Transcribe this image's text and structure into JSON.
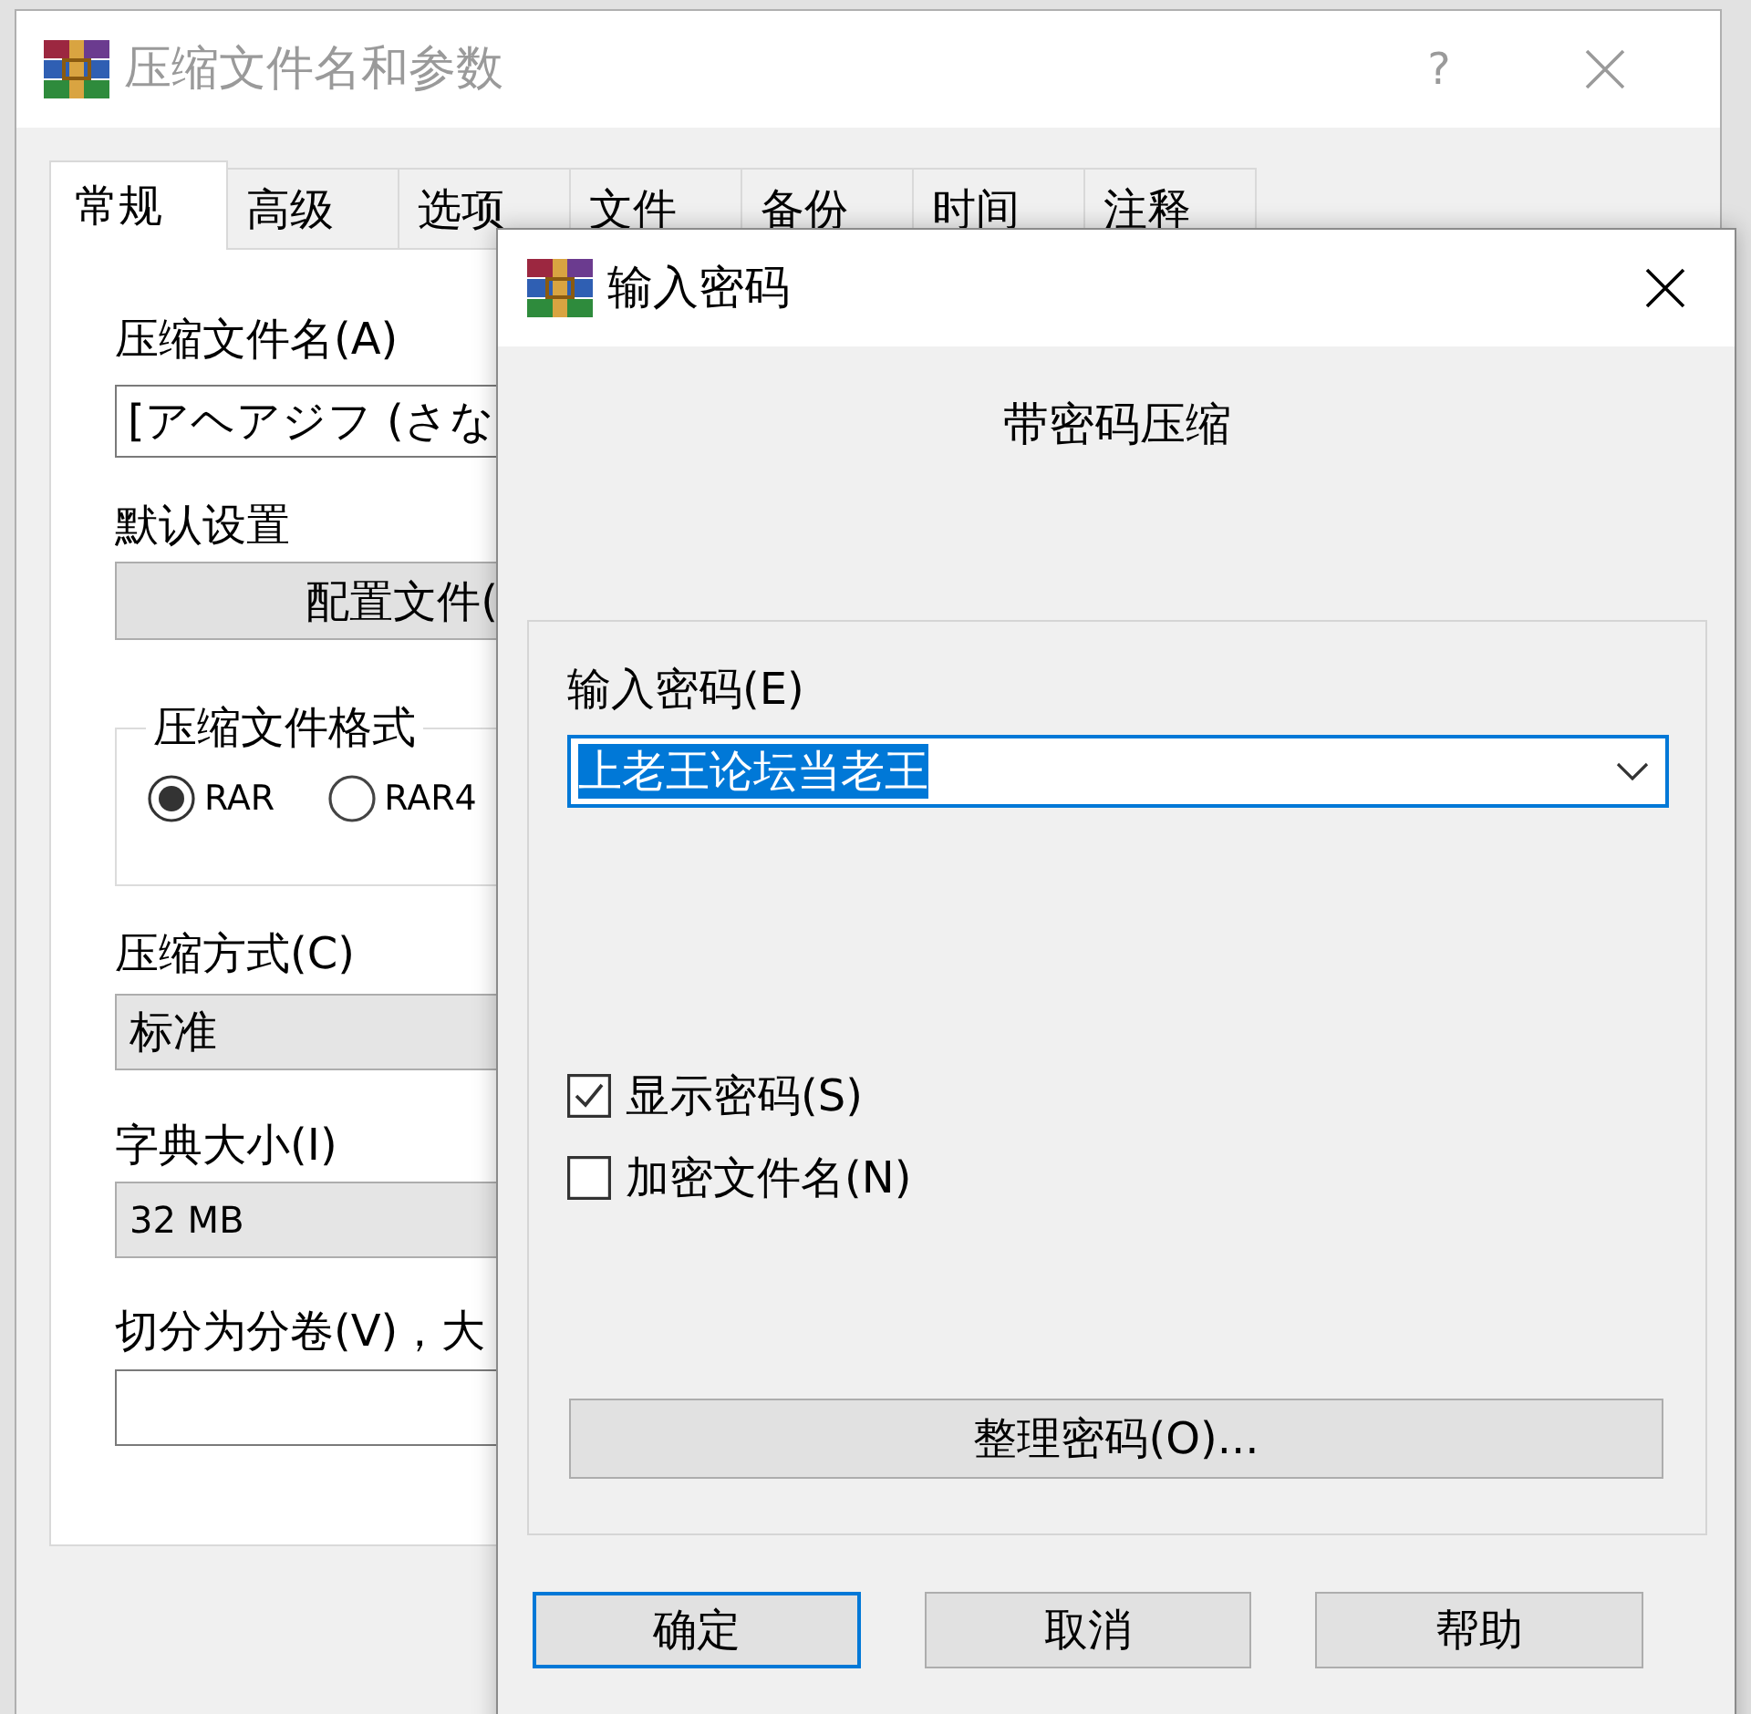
{
  "main_window": {
    "title": "压缩文件名和参数",
    "active": false,
    "help": "?",
    "tabs": [
      {
        "label": "常规",
        "selected": true
      },
      {
        "label": "高级",
        "selected": false
      },
      {
        "label": "选项",
        "selected": false
      },
      {
        "label": "文件",
        "selected": false
      },
      {
        "label": "备份",
        "selected": false
      },
      {
        "label": "时间",
        "selected": false
      },
      {
        "label": "注释",
        "selected": false
      }
    ],
    "archive_name": {
      "label": "压缩文件名(A)",
      "value": "[アヘアジフ (さな"
    },
    "default_settings": {
      "label": "默认设置",
      "button": "配置文件("
    },
    "archive_format": {
      "title": "压缩文件格式",
      "options": [
        {
          "label": "RAR",
          "selected": true
        },
        {
          "label": "RAR4",
          "selected": false
        }
      ]
    },
    "compression_method": {
      "label": "压缩方式(C)",
      "value": "标准"
    },
    "dictionary_size": {
      "label": "字典大小(I)",
      "value": "32 MB"
    },
    "split_volumes": {
      "label": "切分为分卷(V)，大"
    }
  },
  "dialog": {
    "title": "输入密码",
    "active": true,
    "heading": "带密码压缩",
    "password": {
      "label": "输入密码(E)",
      "value": "上老王论坛当老王",
      "focused": true
    },
    "options": [
      {
        "label": "显示密码(S)",
        "checked": true
      },
      {
        "label": "加密文件名(N)",
        "checked": false
      }
    ],
    "organize_button": "整理密码(O)...",
    "buttons": [
      {
        "label": "确定",
        "default": true
      },
      {
        "label": "取消",
        "default": false
      },
      {
        "label": "帮助",
        "default": false
      }
    ]
  }
}
